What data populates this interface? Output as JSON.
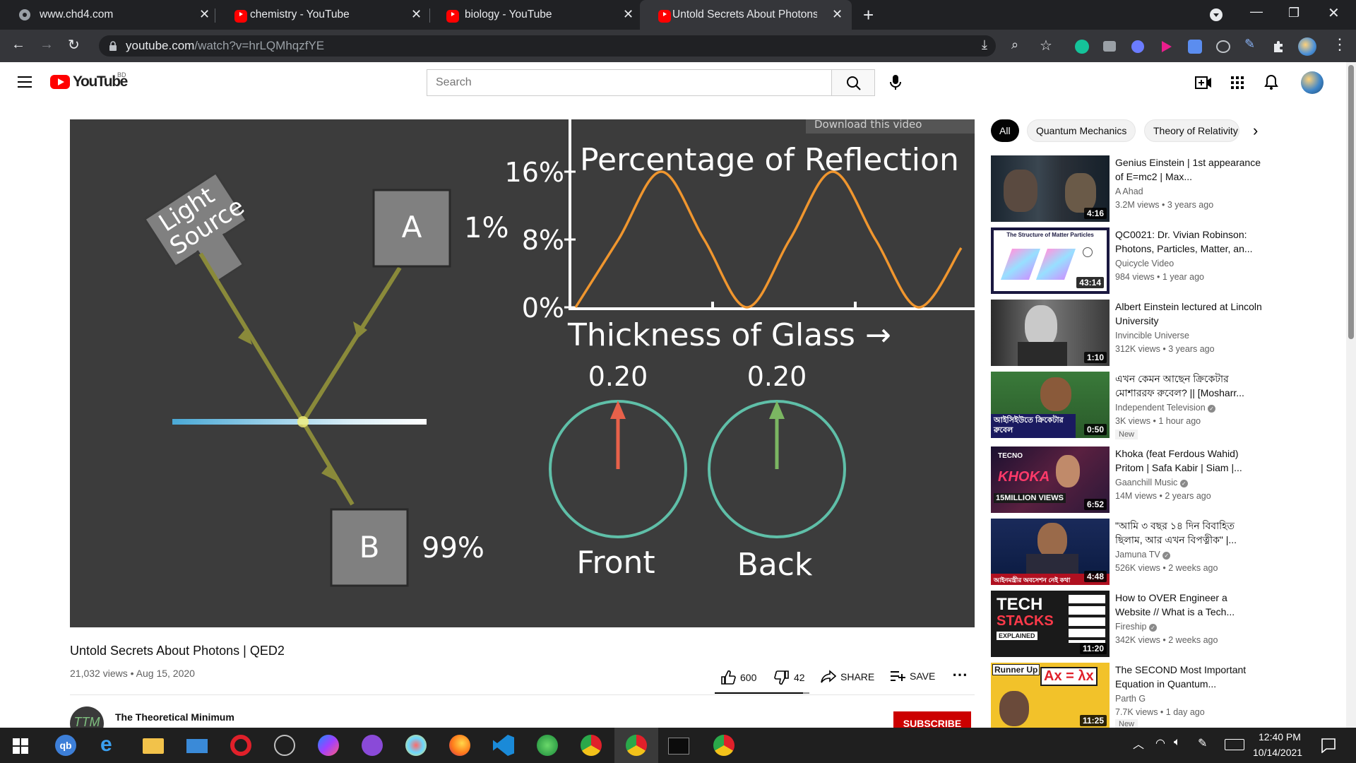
{
  "browser": {
    "tabs": [
      {
        "title": "www.chd4.com",
        "favicon": "globe-icon"
      },
      {
        "title": "chemistry - YouTube",
        "favicon": "youtube-icon"
      },
      {
        "title": "biology - YouTube",
        "favicon": "youtube-icon"
      },
      {
        "title": "Untold Secrets About Photons | QED2",
        "favicon": "youtube-icon",
        "active": true
      }
    ],
    "url_domain": "youtube.com",
    "url_path": "/watch?v=hrLQMhqzfYE"
  },
  "youtube": {
    "logo_text": "YouTube",
    "region": "BD",
    "search_placeholder": "Search",
    "chips": [
      "All",
      "Quantum Mechanics",
      "Theory of Relativity"
    ]
  },
  "video": {
    "download_label": "Download this video",
    "light_source_line1": "Light",
    "light_source_line2": "Source",
    "box_a": "A",
    "box_b": "B",
    "pct_a": "1%",
    "pct_b": "99%",
    "chart_title": "Percentage of Reflection",
    "y_ticks": [
      "16%",
      "8%",
      "0%"
    ],
    "x_label": "Thickness of Glass →",
    "front_value": "0.20",
    "back_value": "0.20",
    "front_label": "Front",
    "back_label": "Back",
    "title": "Untold Secrets About Photons | QED2",
    "views": "21,032 views",
    "date": "Aug 15, 2020",
    "likes": "600",
    "dislikes": "42",
    "share_label": "SHARE",
    "save_label": "SAVE",
    "channel": "The Theoretical Minimum",
    "channel_avatar_text": "TTM",
    "subscribe_label": "SUBSCRIBE"
  },
  "chart_data": {
    "type": "line",
    "title": "Percentage of Reflection",
    "xlabel": "Thickness of Glass →",
    "ylabel": "",
    "y_ticks": [
      "0%",
      "8%",
      "16%"
    ],
    "ylim": [
      0,
      16
    ],
    "series": [
      {
        "values": [
          0,
          8,
          16,
          8,
          0,
          8,
          16,
          8,
          0,
          7
        ]
      }
    ]
  },
  "recommendations": [
    {
      "title": "Genius Einstein | 1st appearance of E=mc2 | Max...",
      "channel": "A Ahad",
      "meta": "3.2M views • 3 years ago",
      "duration": "4:16",
      "verified": false,
      "badge": ""
    },
    {
      "title": "QC0021: Dr. Vivian Robinson: Photons, Particles, Matter, an...",
      "channel": "Quicycle Video",
      "meta": "984 views • 1 year ago",
      "duration": "43:14",
      "verified": false,
      "badge": ""
    },
    {
      "title": "Albert Einstein lectured at Lincoln University",
      "channel": "Invincible Universe",
      "meta": "312K views • 3 years ago",
      "duration": "1:10",
      "verified": false,
      "badge": ""
    },
    {
      "title": "এখন কেমন আছেন ক্রিকেটার মোশাররফ রুবেল? || [Mosharr...",
      "channel": "Independent Television",
      "meta": "3K views • 1 hour ago",
      "duration": "0:50",
      "verified": true,
      "badge": "New"
    },
    {
      "title": "Khoka (feat Ferdous Wahid) Pritom | Safa Kabir | Siam |...",
      "channel": "Gaanchill Music",
      "meta": "14M views • 2 years ago",
      "duration": "6:52",
      "verified": true,
      "badge": ""
    },
    {
      "title": "\"আমি ৩ বছর ১৪ দিন বিবাহিত ছিলাম, আর এখন বিপত্নীক\" |...",
      "channel": "Jamuna TV",
      "meta": "526K views • 2 weeks ago",
      "duration": "4:48",
      "verified": true,
      "badge": ""
    },
    {
      "title": "How to OVER Engineer a Website // What is a Tech...",
      "channel": "Fireship",
      "meta": "342K views • 2 weeks ago",
      "duration": "11:20",
      "verified": true,
      "badge": ""
    },
    {
      "title": "The SECOND Most Important Equation in Quantum...",
      "channel": "Parth G",
      "meta": "7.7K views • 1 day ago",
      "duration": "11:25",
      "verified": false,
      "badge": "New"
    }
  ],
  "thumb_text": {
    "rec2_title": "The Structure of Matter Particles",
    "rec4_overlay": "আইসিইউতে ক্রিকেটার রুবেল",
    "rec5_brand": "TECNO",
    "rec5_overlay": "KHOKA",
    "rec5_views": "15MILLION VIEWS",
    "rec6_overlay": "আইনমন্ত্রীর অবসেশন নেই কথা",
    "rec7_line1": "TECH",
    "rec7_line2": "STACKS",
    "rec7_line3": "EXPLAINED",
    "rec8_runner": "Runner Up",
    "rec8_eq": "Ax = λx"
  },
  "taskbar": {
    "time": "12:40 PM",
    "date": "10/14/2021"
  },
  "colors": {
    "youtube_red": "#ff0000",
    "chart_curve": "#f0962e",
    "front_arrow": "#e8614a",
    "back_arrow": "#7bb662",
    "clock_ring": "#5fbfa8"
  }
}
